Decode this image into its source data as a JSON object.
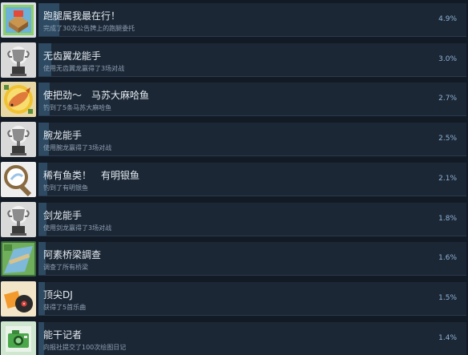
{
  "achievements": [
    {
      "title": "跑腿属我最在行！",
      "desc": "完成了30次公告牌上的跑腿委托",
      "percent": "4.9%",
      "rate": 4.9,
      "icon": "delivery-box-icon"
    },
    {
      "title": "无齿翼龙能手",
      "desc": "使用无齿翼龙赢得了3场对战",
      "percent": "3.0%",
      "rate": 3.0,
      "icon": "trophy-icon"
    },
    {
      "title": "使把劲～　马苏大麻哈鱼",
      "desc": "钓到了5条马苏大麻哈鱼",
      "percent": "2.7%",
      "rate": 2.7,
      "icon": "salmon-icon"
    },
    {
      "title": "腕龙能手",
      "desc": "使用腕龙赢得了3场对战",
      "percent": "2.5%",
      "rate": 2.5,
      "icon": "trophy-icon"
    },
    {
      "title": "稀有鱼类！　有明银鱼",
      "desc": "钓到了有明银鱼",
      "percent": "2.1%",
      "rate": 2.1,
      "icon": "magnifier-icon"
    },
    {
      "title": "剑龙能手",
      "desc": "使用剑龙赢得了3场对战",
      "percent": "1.8%",
      "rate": 1.8,
      "icon": "trophy-icon"
    },
    {
      "title": "阿素桥梁調查",
      "desc": "调查了所有桥梁",
      "percent": "1.6%",
      "rate": 1.6,
      "icon": "bridge-map-icon"
    },
    {
      "title": "顶尖DJ",
      "desc": "获得了5首乐曲",
      "percent": "1.5%",
      "rate": 1.5,
      "icon": "music-record-icon"
    },
    {
      "title": "能干记者",
      "desc": "向报社提交了100次绘图日记",
      "percent": "1.4%",
      "rate": 1.4,
      "icon": "camera-icon"
    }
  ],
  "colors": {
    "background": "#121a25",
    "panel": "#1c2735",
    "fill": "#2d4a62",
    "percent_text": "#8fb4d8"
  }
}
